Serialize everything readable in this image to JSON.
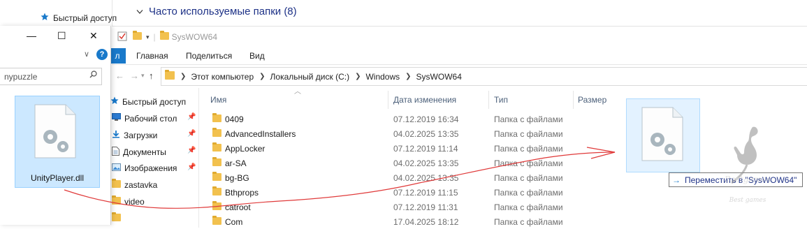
{
  "background_window": {
    "quick_access": "Быстрый доступ",
    "group_header": "Часто используемые папки (8)"
  },
  "left_window": {
    "minimize": "—",
    "maximize": "☐",
    "close": "✕",
    "help": "?",
    "search_value": "nypuzzle",
    "file_name": "UnityPlayer.dll"
  },
  "main_window": {
    "title": "SysWOW64",
    "file_tab": "л",
    "tabs": [
      "Главная",
      "Поделиться",
      "Вид"
    ],
    "breadcrumbs": [
      "Этот компьютер",
      "Локальный диск (C:)",
      "Windows",
      "SysWOW64"
    ],
    "nav_pane": [
      {
        "label": "Быстрый доступ",
        "icon": "star-icon",
        "pinned": false
      },
      {
        "label": "Рабочий стол",
        "icon": "desktop-icon",
        "pinned": true
      },
      {
        "label": "Загрузки",
        "icon": "download-icon",
        "pinned": true
      },
      {
        "label": "Документы",
        "icon": "documents-icon",
        "pinned": true
      },
      {
        "label": "Изображения",
        "icon": "pictures-icon",
        "pinned": true
      },
      {
        "label": "zastavka",
        "icon": "folder-icon",
        "pinned": false
      },
      {
        "label": "video",
        "icon": "folder-icon",
        "pinned": false
      }
    ],
    "columns": {
      "name": "Имя",
      "date": "Дата изменения",
      "type": "Тип",
      "size": "Размер"
    },
    "files": [
      {
        "name": "0409",
        "date": "07.12.2019 16:34",
        "type": "Папка с файлами"
      },
      {
        "name": "AdvancedInstallers",
        "date": "04.02.2025 13:35",
        "type": "Папка с файлами"
      },
      {
        "name": "AppLocker",
        "date": "07.12.2019 11:14",
        "type": "Папка с файлами"
      },
      {
        "name": "ar-SA",
        "date": "04.02.2025 13:35",
        "type": "Папка с файлами"
      },
      {
        "name": "bg-BG",
        "date": "04.02.2025 13:35",
        "type": "Папка с файлами"
      },
      {
        "name": "Bthprops",
        "date": "07.12.2019 11:15",
        "type": "Папка с файлами"
      },
      {
        "name": "catroot",
        "date": "07.12.2019 11:31",
        "type": "Папка с файлами"
      },
      {
        "name": "Com",
        "date": "17.04.2025 18:12",
        "type": "Папка с файлами"
      }
    ]
  },
  "drag": {
    "tooltip": "Переместить в \"SysWOW64\""
  },
  "watermark": {
    "text": "Bestgames",
    "sub": "Best games"
  },
  "colors": {
    "accent": "#1979ca",
    "selection": "#cce8ff",
    "folder": "#f2c14e",
    "annotation": "#e03a3a"
  }
}
